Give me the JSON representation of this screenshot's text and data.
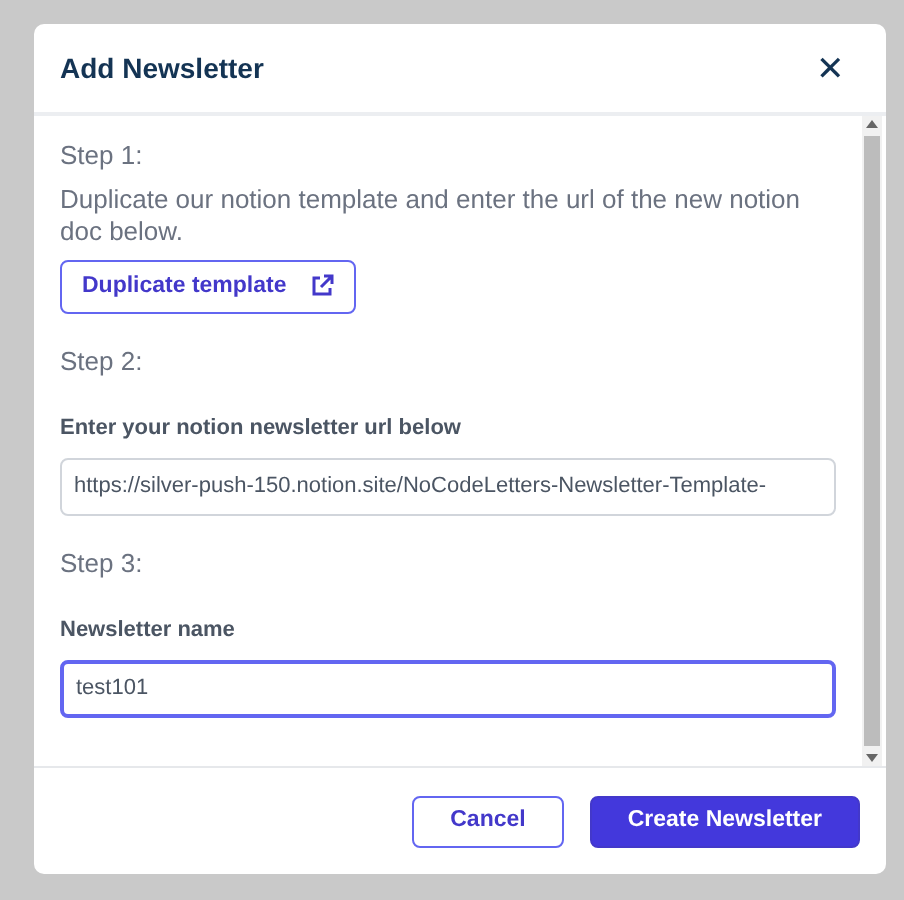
{
  "dialog": {
    "title": "Add Newsletter",
    "close_icon": "✕"
  },
  "steps": [
    {
      "heading": "Step 1:",
      "description": "Duplicate our notion template and enter the url of the new notion doc below.",
      "button": "Duplicate template"
    },
    {
      "heading": "Step 2:",
      "field": {
        "label": "Enter your notion newsletter url below",
        "value": "https://silver-push-150.notion.site/NoCodeLetters-Newsletter-Template-",
        "focused": false
      }
    },
    {
      "heading": "Step 3:",
      "field": {
        "label": "Newsletter name",
        "value": "test101",
        "focused": true
      }
    }
  ],
  "buttons": [
    {
      "label": "Cancel",
      "kind": "secondary"
    },
    {
      "label": "Create Newsletter",
      "kind": "primary"
    }
  ]
}
